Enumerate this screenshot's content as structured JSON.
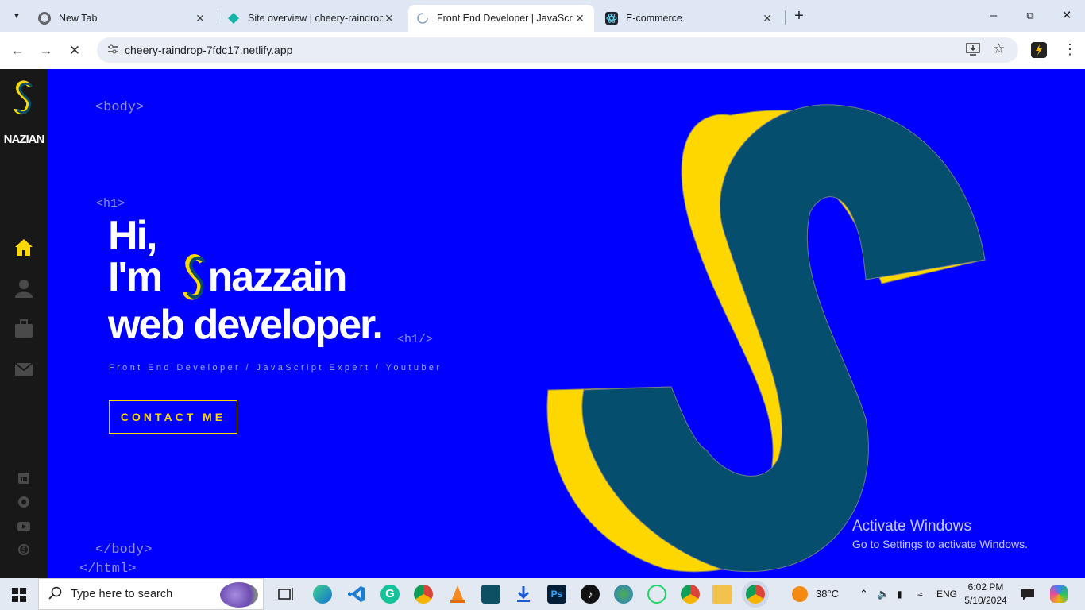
{
  "browser": {
    "tabs": [
      {
        "label": "New Tab",
        "icon": "chrome-icon"
      },
      {
        "label": "Site overview | cheery-raindrop",
        "icon": "netlify-icon"
      },
      {
        "label": "Front End Developer | JavaScrip",
        "icon": "loading-spinner-icon",
        "active": true
      },
      {
        "label": "E-commerce",
        "icon": "react-icon"
      }
    ],
    "url": "cheery-raindrop-7fdc17.netlify.app"
  },
  "site": {
    "brand": "NAZIAN",
    "tags": {
      "body_open": "<body>",
      "h1_open": "<h1>",
      "h1_close": "<h1/>",
      "body_close": "</body>",
      "html_close": "</html>"
    },
    "hero": {
      "line1": "Hi,",
      "line2_prefix": "I'm",
      "line2_rest": "nazzain",
      "line3": "web developer."
    },
    "subtitle": "Front End Developer / JavaScript Expert / Youtuber",
    "cta": "CONTACT ME",
    "colors": {
      "background": "#0000ff",
      "accent": "#ffd700",
      "logo_dark": "#054e6e",
      "sidebar": "#181818"
    }
  },
  "watermark": {
    "title": "Activate Windows",
    "subtitle": "Go to Settings to activate Windows."
  },
  "taskbar": {
    "search_placeholder": "Type here to search",
    "weather": "38°C",
    "language": "ENG",
    "time": "6:02 PM",
    "date": "5/10/2024"
  }
}
